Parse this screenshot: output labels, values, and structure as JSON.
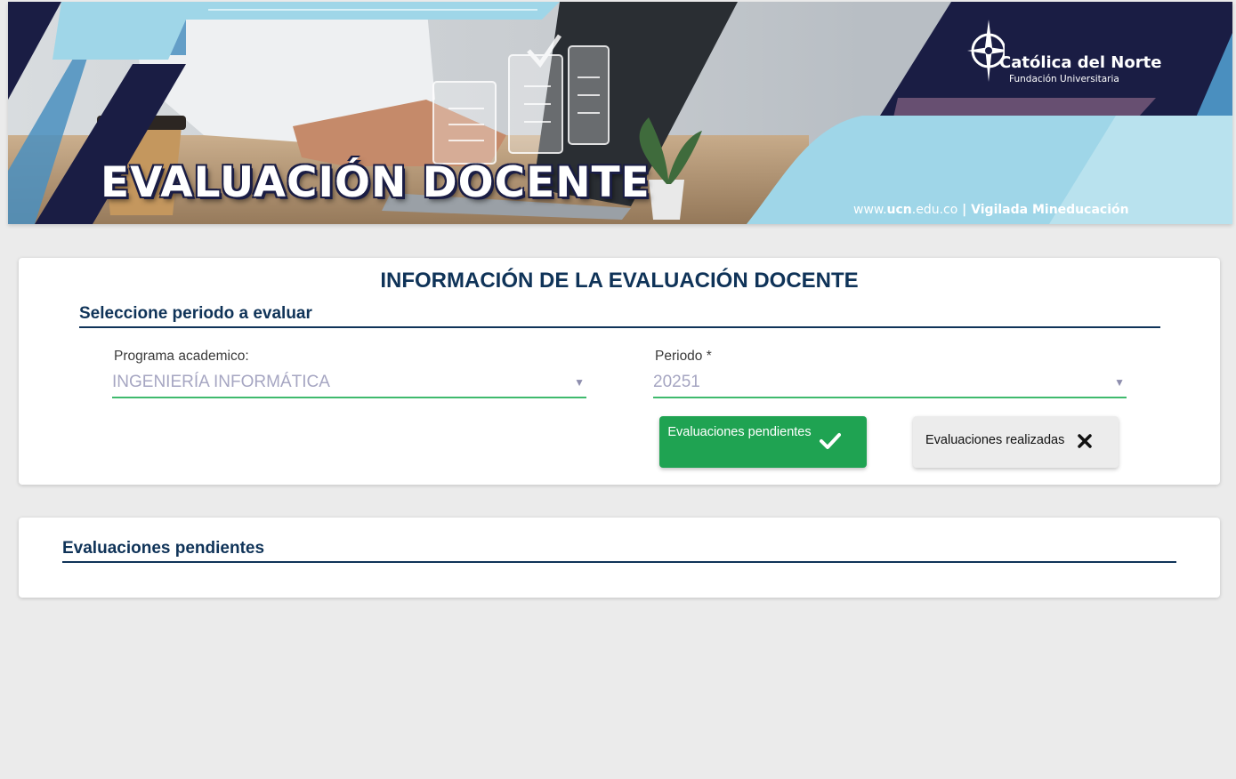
{
  "banner": {
    "title": "EVALUACIÓN DOCENTE",
    "logo_name": "Católica del Norte",
    "logo_sub": "Fundación Universitaria",
    "footer_url_prefix": "www.",
    "footer_url_bold": "ucn",
    "footer_url_suffix": ".edu.co",
    "footer_sep": " | ",
    "footer_vigilada": "Vigilada Mineducación"
  },
  "info": {
    "title": "INFORMACIÓN DE LA EVALUACIÓN DOCENTE",
    "section_heading": "Seleccione periodo a evaluar",
    "program": {
      "label": "Programa academico:",
      "value": "INGENIERÍA INFORMÁTICA"
    },
    "period": {
      "label": "Periodo *",
      "value": "20251"
    },
    "buttons": {
      "pending": "Evaluaciones pendientes",
      "completed": "Evaluaciones realizadas"
    }
  },
  "pending": {
    "heading": "Evaluaciones pendientes"
  },
  "icons": {
    "pending_button": "check-icon",
    "completed_button": "close-icon",
    "select_arrow": "caret-down-icon",
    "logo": "compass-star-icon"
  },
  "colors": {
    "primary": "#0f3358",
    "accent_green": "#1fa352",
    "field_underline": "#3fba6d",
    "banner_navy": "#1a1d44",
    "banner_light_blue": "#9fd6e8"
  }
}
